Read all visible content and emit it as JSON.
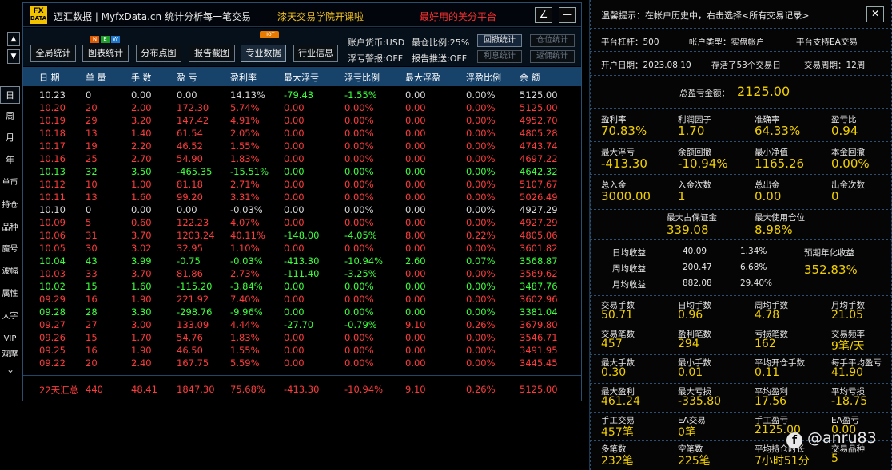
{
  "app": {
    "logo_text": "FX",
    "logo_sub": "DATA",
    "title": "迈汇数据 | MyfxData.cn   统计分析每一笔交易",
    "promo_1": "漆天交易学院开课啦",
    "promo_2": "最好用的美分平台",
    "edit_icon": "∠",
    "minimize_icon": "—"
  },
  "toolbar": {
    "buttons": [
      "全局统计",
      "图表统计",
      "分布点图",
      "报告截图",
      "专业数据",
      "行业信息"
    ],
    "badge_n": "N",
    "badge_e": "E",
    "badge_w": "W",
    "hot_badge": "HOT",
    "account_currency": "账户货币:USD",
    "max_ratio": "最仓比例:25%",
    "float_alert": "浮亏警报:OFF",
    "report_push": "报告推送:OFF",
    "btn_drawdown_stats": "回撤统计",
    "btn_position_stats": "仓位统计",
    "btn_interest_stats": "利息统计",
    "btn_rebate_stats": "返佣统计"
  },
  "table": {
    "headers": [
      "日 期",
      "单 量",
      "手 数",
      "盈 亏",
      "盈利率",
      "最大浮亏",
      "浮亏比例",
      "最大浮盈",
      "浮盈比例",
      "余 额"
    ],
    "rows": [
      {
        "color": "white",
        "cells": [
          "10.23",
          "0",
          "0.00",
          "0.00",
          "14.13%",
          "-79.43",
          "-1.55%",
          "0.00",
          "0.00%",
          "5125.00"
        ]
      },
      {
        "color": "red",
        "cells": [
          "10.20",
          "20",
          "2.00",
          "172.30",
          "5.74%",
          "0.00",
          "0.00%",
          "0.00",
          "0.00%",
          "5125.00"
        ]
      },
      {
        "color": "red",
        "cells": [
          "10.19",
          "29",
          "3.20",
          "147.42",
          "4.91%",
          "0.00",
          "0.00%",
          "0.00",
          "0.00%",
          "4952.70"
        ]
      },
      {
        "color": "red",
        "cells": [
          "10.18",
          "13",
          "1.40",
          "61.54",
          "2.05%",
          "0.00",
          "0.00%",
          "0.00",
          "0.00%",
          "4805.28"
        ]
      },
      {
        "color": "red",
        "cells": [
          "10.17",
          "19",
          "2.20",
          "46.52",
          "1.55%",
          "0.00",
          "0.00%",
          "0.00",
          "0.00%",
          "4743.74"
        ]
      },
      {
        "color": "red",
        "cells": [
          "10.16",
          "25",
          "2.70",
          "54.90",
          "1.83%",
          "0.00",
          "0.00%",
          "0.00",
          "0.00%",
          "4697.22"
        ]
      },
      {
        "color": "green",
        "cells": [
          "10.13",
          "32",
          "3.50",
          "-465.35",
          "-15.51%",
          "0.00",
          "0.00%",
          "0.00",
          "0.00%",
          "4642.32"
        ]
      },
      {
        "color": "red",
        "cells": [
          "10.12",
          "10",
          "1.00",
          "81.18",
          "2.71%",
          "0.00",
          "0.00%",
          "0.00",
          "0.00%",
          "5107.67"
        ]
      },
      {
        "color": "red",
        "cells": [
          "10.11",
          "13",
          "1.60",
          "99.20",
          "3.31%",
          "0.00",
          "0.00%",
          "0.00",
          "0.00%",
          "5026.49"
        ]
      },
      {
        "color": "white",
        "cells": [
          "10.10",
          "0",
          "0.00",
          "0.00",
          "-0.03%",
          "0.00",
          "0.00%",
          "0.00",
          "0.00%",
          "4927.29"
        ]
      },
      {
        "color": "red",
        "cells": [
          "10.09",
          "5",
          "0.60",
          "122.23",
          "4.07%",
          "0.00",
          "0.00%",
          "0.00",
          "0.00%",
          "4927.29"
        ]
      },
      {
        "color": "red",
        "cells": [
          "10.06",
          "31",
          "3.70",
          "1203.24",
          "40.11%",
          "-148.00",
          "-4.05%",
          "8.00",
          "0.22%",
          "4805.06"
        ]
      },
      {
        "color": "red",
        "cells": [
          "10.05",
          "30",
          "3.02",
          "32.95",
          "1.10%",
          "0.00",
          "0.00%",
          "0.00",
          "0.00%",
          "3601.82"
        ]
      },
      {
        "color": "green",
        "cells": [
          "10.04",
          "43",
          "3.99",
          "-0.75",
          "-0.03%",
          "-413.30",
          "-10.94%",
          "2.60",
          "0.07%",
          "3568.87"
        ]
      },
      {
        "color": "red",
        "cells": [
          "10.03",
          "33",
          "3.70",
          "81.86",
          "2.73%",
          "-111.40",
          "-3.25%",
          "0.00",
          "0.00%",
          "3569.62"
        ]
      },
      {
        "color": "green",
        "cells": [
          "10.02",
          "15",
          "1.60",
          "-115.20",
          "-3.84%",
          "0.00",
          "0.00%",
          "0.00",
          "0.00%",
          "3487.76"
        ]
      },
      {
        "color": "red",
        "cells": [
          "09.29",
          "16",
          "1.90",
          "221.92",
          "7.40%",
          "0.00",
          "0.00%",
          "0.00",
          "0.00%",
          "3602.96"
        ]
      },
      {
        "color": "green",
        "cells": [
          "09.28",
          "28",
          "3.30",
          "-298.76",
          "-9.96%",
          "0.00",
          "0.00%",
          "0.00",
          "0.00%",
          "3381.04"
        ]
      },
      {
        "color": "red",
        "cells": [
          "09.27",
          "27",
          "3.00",
          "133.09",
          "4.44%",
          "-27.70",
          "-0.79%",
          "9.10",
          "0.26%",
          "3679.80"
        ]
      },
      {
        "color": "red",
        "cells": [
          "09.26",
          "15",
          "1.70",
          "54.76",
          "1.83%",
          "0.00",
          "0.00%",
          "0.00",
          "0.00%",
          "3546.71"
        ]
      },
      {
        "color": "red",
        "cells": [
          "09.25",
          "16",
          "1.90",
          "46.50",
          "1.55%",
          "0.00",
          "0.00%",
          "0.00",
          "0.00%",
          "3491.95"
        ]
      },
      {
        "color": "red",
        "cells": [
          "09.22",
          "20",
          "2.40",
          "167.75",
          "5.59%",
          "0.00",
          "0.00%",
          "0.00",
          "0.00%",
          "3445.45"
        ]
      }
    ],
    "summary": [
      "22天汇总",
      "440",
      "48.41",
      "1847.30",
      "75.68%",
      "-413.30",
      "-10.94%",
      "9.10",
      "0.26%",
      "5125.00"
    ]
  },
  "side_tabs": [
    "日",
    "周",
    "月",
    "年",
    "单币",
    "持仓",
    "品种",
    "魔号",
    "波幅",
    "属性",
    "大字",
    "VIP",
    "观摩"
  ],
  "side_more": "⌄",
  "scroll_up": "▲",
  "scroll_down": "▼",
  "panel": {
    "hint": "温馨提示：在帐户历史中，右击选择<所有交易记录>",
    "close_icon": "✕",
    "leverage": "平台杠杆：500",
    "account_type": "帐户类型：实盘帐户",
    "ea_support": "平台支持EA交易",
    "open_date": "开户日期：2023.08.10",
    "alive": "存活了53个交易日",
    "cycle": "交易周期：12周",
    "total_pl_label": "总盈亏金额：",
    "total_pl_value": "2125.00",
    "grid1": [
      {
        "label": "盈利率",
        "value": "70.83%"
      },
      {
        "label": "利润因子",
        "value": "1.70"
      },
      {
        "label": "准确率",
        "value": "64.33%"
      },
      {
        "label": "盈亏比",
        "value": "0.94"
      },
      {
        "label": "最大浮亏",
        "value": "-413.30"
      },
      {
        "label": "余额回撤",
        "value": "-10.94%"
      },
      {
        "label": "最小净值",
        "value": "1165.26"
      },
      {
        "label": "本金回撤",
        "value": "0.00%"
      },
      {
        "label": "总入金",
        "value": "3000.00"
      },
      {
        "label": "入金次数",
        "value": "1"
      },
      {
        "label": "总出金",
        "value": "0.00"
      },
      {
        "label": "出金次数",
        "value": "0"
      }
    ],
    "margin": [
      {
        "label": "最大占保证金",
        "value": "339.08"
      },
      {
        "label": "最大使用仓位",
        "value": "8.98%"
      }
    ],
    "avg_returns": [
      {
        "label": "日均收益",
        "amount": "40.09",
        "pct": "1.34%"
      },
      {
        "label": "周均收益",
        "amount": "200.47",
        "pct": "6.68%"
      },
      {
        "label": "月均收益",
        "amount": "882.08",
        "pct": "29.40%"
      }
    ],
    "annual_label": "预期年化收益",
    "annual_value": "352.83%",
    "grid2": [
      {
        "label": "交易手数",
        "value": "50.71"
      },
      {
        "label": "日均手数",
        "value": "0.96"
      },
      {
        "label": "周均手数",
        "value": "4.78"
      },
      {
        "label": "月均手数",
        "value": "21.05"
      },
      {
        "label": "交易笔数",
        "value": "457"
      },
      {
        "label": "盈利笔数",
        "value": "294"
      },
      {
        "label": "亏损笔数",
        "value": "162"
      },
      {
        "label": "交易频率",
        "value": "9笔/天"
      },
      {
        "label": "最大手数",
        "value": "0.30"
      },
      {
        "label": "最小手数",
        "value": "0.01"
      },
      {
        "label": "平均开仓手数",
        "value": "0.11"
      },
      {
        "label": "每手平均盈亏",
        "value": "41.90"
      },
      {
        "label": "最大盈利",
        "value": "461.24"
      },
      {
        "label": "最大亏损",
        "value": "-335.80"
      },
      {
        "label": "平均盈利",
        "value": "17.56"
      },
      {
        "label": "平均亏损",
        "value": "-18.75"
      },
      {
        "label": "手工交易",
        "value": "457笔"
      },
      {
        "label": "EA交易",
        "value": "0笔"
      },
      {
        "label": "手工盈亏",
        "value": "2125.00"
      },
      {
        "label": "EA盈亏",
        "value": "0.00"
      },
      {
        "label": "多笔数",
        "value": "232笔"
      },
      {
        "label": "空笔数",
        "value": "225笔"
      },
      {
        "label": "平均持仓时长",
        "value": "7小时51分"
      },
      {
        "label": "交易品种",
        "value": "5"
      }
    ]
  },
  "watermark": {
    "icon": "f",
    "text": "@anru83"
  },
  "colors": {
    "red": "#ff3b3b",
    "green": "#3cff3c",
    "white": "#d8d8d8",
    "gold": "#f2d000",
    "header_blue": "#17426a"
  }
}
